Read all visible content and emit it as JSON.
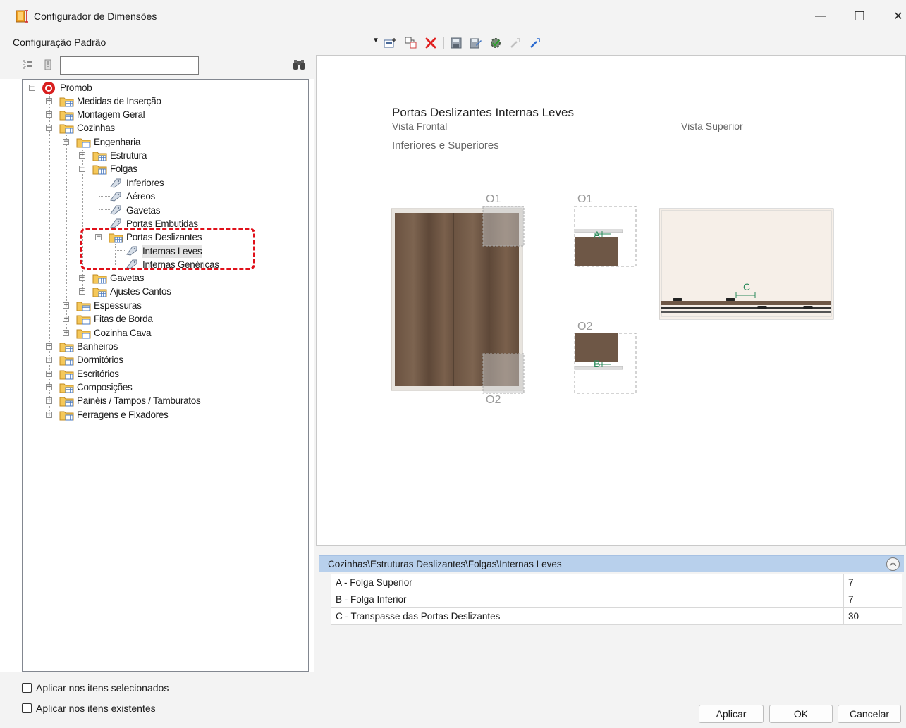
{
  "window": {
    "title": "Configurador de Dimensões",
    "minimize": "—",
    "maximize": "☐",
    "close": "✕"
  },
  "config": {
    "name": "Configuração Padrão"
  },
  "toolbar": {
    "icons": [
      "new-icon",
      "copy-icon",
      "delete-icon",
      "save-icon",
      "save-as-icon",
      "settings-icon",
      "export-icon",
      "import-icon"
    ]
  },
  "search": {
    "value": "",
    "placeholder": ""
  },
  "tree": {
    "root": "Promob",
    "items": [
      "Medidas de Inserção",
      "Montagem Geral",
      "Cozinhas",
      "Engenharia",
      "Estrutura",
      "Folgas",
      "Inferiores",
      "Aéreos",
      "Gavetas",
      "Portas Embutidas",
      "Portas Deslizantes",
      "Internas Leves",
      "Internas Genéricas",
      "Gavetas",
      "Ajustes Cantos",
      "Espessuras",
      "Fitas de Borda",
      "Cozinha Cava",
      "Banheiros",
      "Dormitórios",
      "Escritórios",
      "Composições",
      "Painéis / Tampos / Tamburatos",
      "Ferragens e Fixadores"
    ]
  },
  "options": {
    "apply_selected": "Aplicar nos itens selecionados",
    "apply_existing": "Aplicar nos itens existentes"
  },
  "preview": {
    "title": "Portas Deslizantes Internas Leves",
    "front_view": "Vista Frontal",
    "top_view": "Vista Superior",
    "subtitle": "Inferiores e Superiores",
    "labels": {
      "o1": "O1",
      "o2": "O2",
      "a": "A",
      "b": "B",
      "c": "C"
    }
  },
  "properties": {
    "path": "Cozinhas\\Estruturas Deslizantes\\Folgas\\Internas Leves",
    "rows": [
      {
        "name": "A - Folga Superior",
        "value": "7"
      },
      {
        "name": "B - Folga Inferior",
        "value": "7"
      },
      {
        "name": "C - Transpasse das Portas Deslizantes",
        "value": "30"
      }
    ]
  },
  "buttons": {
    "apply": "Aplicar",
    "ok": "OK",
    "cancel": "Cancelar"
  },
  "colors": {
    "highlight": "#e0101a",
    "path_bar": "#b8d0ec",
    "wood": "#6e5746",
    "delete": "#e02020"
  }
}
